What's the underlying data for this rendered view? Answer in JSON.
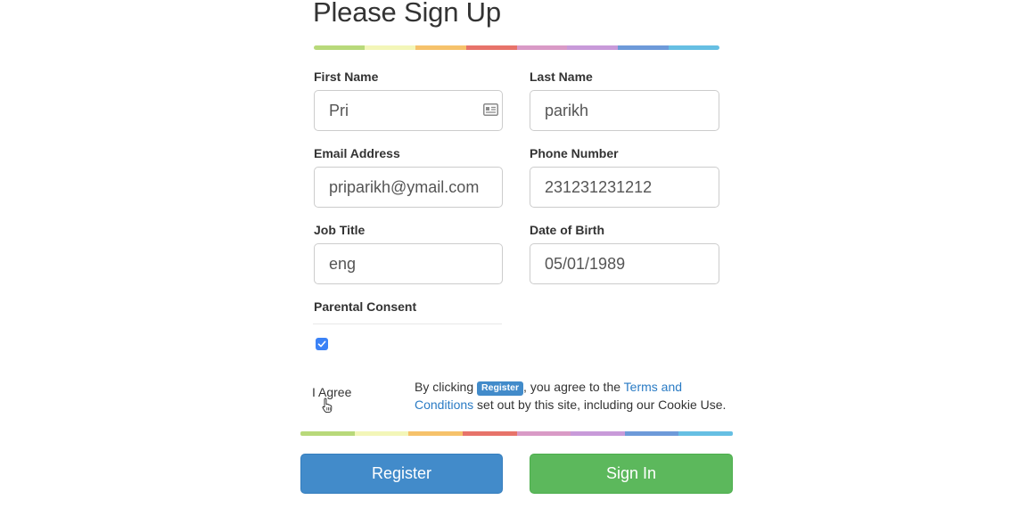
{
  "header": {
    "title": "Please Sign Up"
  },
  "stripe_colors": [
    "#b8d97a",
    "#f3f6b8",
    "#f6c26b",
    "#e7736a",
    "#d99ac6",
    "#c89ad9",
    "#6d9ad9",
    "#66bfe3"
  ],
  "form": {
    "first_name": {
      "label": "First Name",
      "value": "Pri",
      "icon": "contact-card-icon"
    },
    "last_name": {
      "label": "Last Name",
      "value": "parikh"
    },
    "email": {
      "label": "Email Address",
      "value": "priparikh@ymail.com"
    },
    "phone": {
      "label": "Phone Number",
      "value": "231231231212"
    },
    "job_title": {
      "label": "Job Title",
      "value": "eng"
    },
    "dob": {
      "label": "Date of Birth",
      "value": "05/01/1989"
    },
    "parental_consent": {
      "label": "Parental Consent",
      "checked": true
    }
  },
  "agree": {
    "label": "I Agree"
  },
  "terms": {
    "prefix": "By clicking",
    "badge": "Register",
    "middle": ", you agree to the",
    "link": "Terms and Conditions",
    "suffix": "set out by this site, including our Cookie Use."
  },
  "actions": {
    "register_label": "Register",
    "signin_label": "Sign In"
  },
  "colors": {
    "primary": "#428bca",
    "success": "#5cb85c",
    "checkbox": "#3b82f6",
    "link": "#2a7bc4"
  }
}
